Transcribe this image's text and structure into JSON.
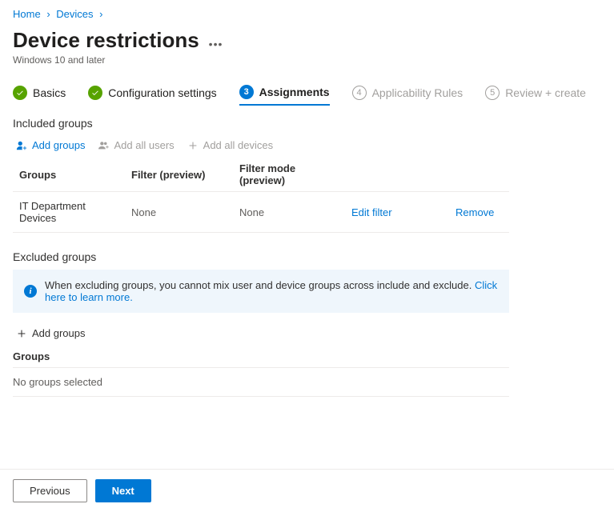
{
  "breadcrumb": {
    "items": [
      "Home",
      "Devices"
    ]
  },
  "page": {
    "title": "Device restrictions",
    "subtitle": "Windows 10 and later"
  },
  "stepper": {
    "steps": [
      {
        "num": "✓",
        "label": "Basics"
      },
      {
        "num": "✓",
        "label": "Configuration settings"
      },
      {
        "num": "3",
        "label": "Assignments"
      },
      {
        "num": "4",
        "label": "Applicability Rules"
      },
      {
        "num": "5",
        "label": "Review + create"
      }
    ]
  },
  "included": {
    "heading": "Included groups",
    "toolbar": {
      "add_groups": "Add groups",
      "add_all_users": "Add all users",
      "add_all_devices": "Add all devices"
    },
    "columns": {
      "groups": "Groups",
      "filter": "Filter (preview)",
      "filter_mode": "Filter mode (preview)"
    },
    "rows": [
      {
        "group": "IT Department Devices",
        "filter": "None",
        "filter_mode": "None",
        "edit": "Edit filter",
        "remove": "Remove"
      }
    ]
  },
  "excluded": {
    "heading": "Excluded groups",
    "banner_text": "When excluding groups, you cannot mix user and device groups across include and exclude. ",
    "banner_link": "Click here to learn more.",
    "add_groups": "Add groups",
    "column": "Groups",
    "empty": "No groups selected"
  },
  "footer": {
    "previous": "Previous",
    "next": "Next"
  }
}
